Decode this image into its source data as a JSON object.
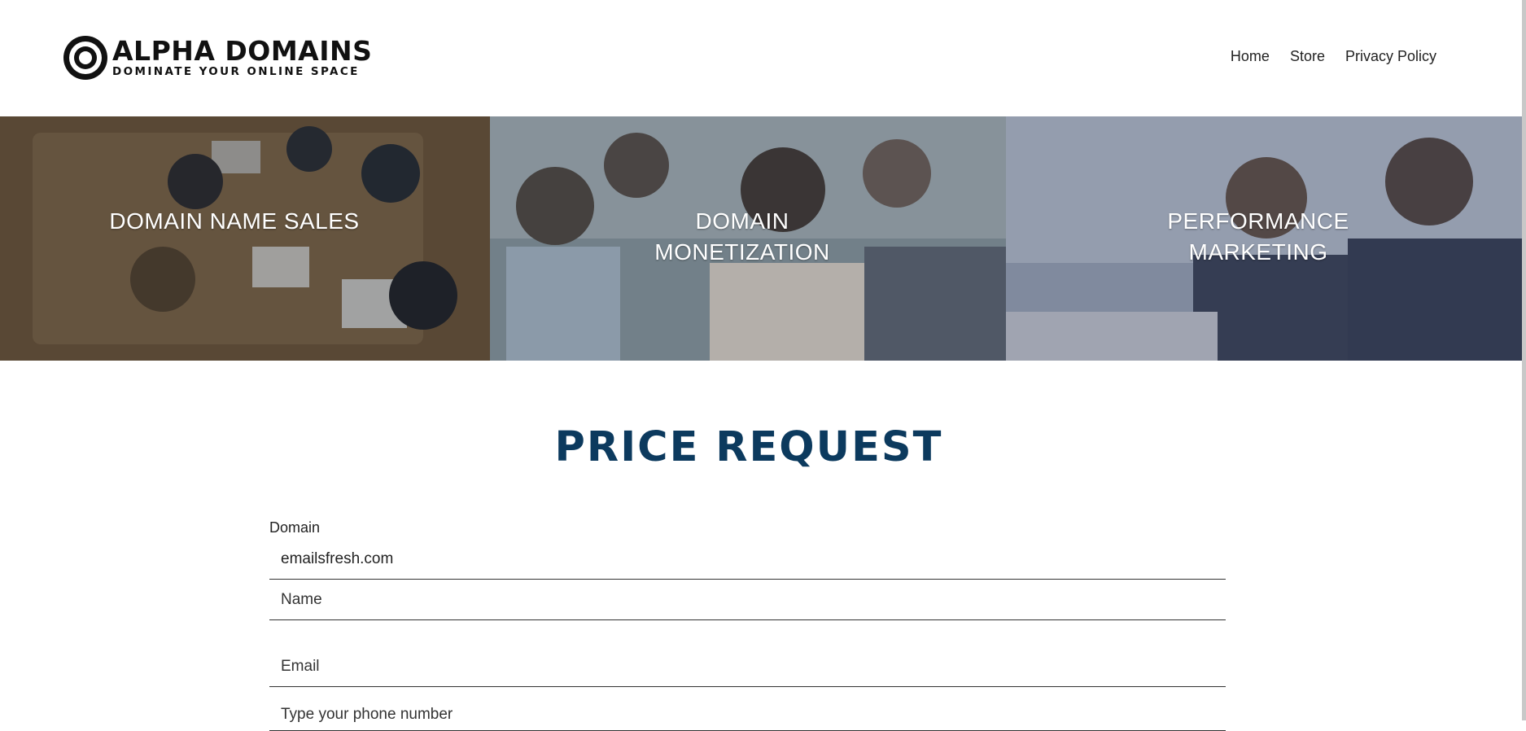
{
  "header": {
    "logo": {
      "title": "ALPHA DOMAINS",
      "tagline": "DOMINATE YOUR ONLINE SPACE"
    },
    "nav": [
      "Home",
      "Store",
      "Privacy Policy"
    ]
  },
  "banner": [
    {
      "caption": "DOMAIN NAME SALES"
    },
    {
      "caption": "DOMAIN MONETIZATION"
    },
    {
      "caption": "PERFORMANCE MARKETING"
    }
  ],
  "form": {
    "title": "PRICE REQUEST",
    "domain_label": "Domain",
    "domain_value": "emailsfresh.com",
    "name_placeholder": "Name",
    "email_placeholder": "Email",
    "phone_placeholder": "Type your phone number"
  },
  "colors": {
    "title": "#0c3a5e"
  }
}
